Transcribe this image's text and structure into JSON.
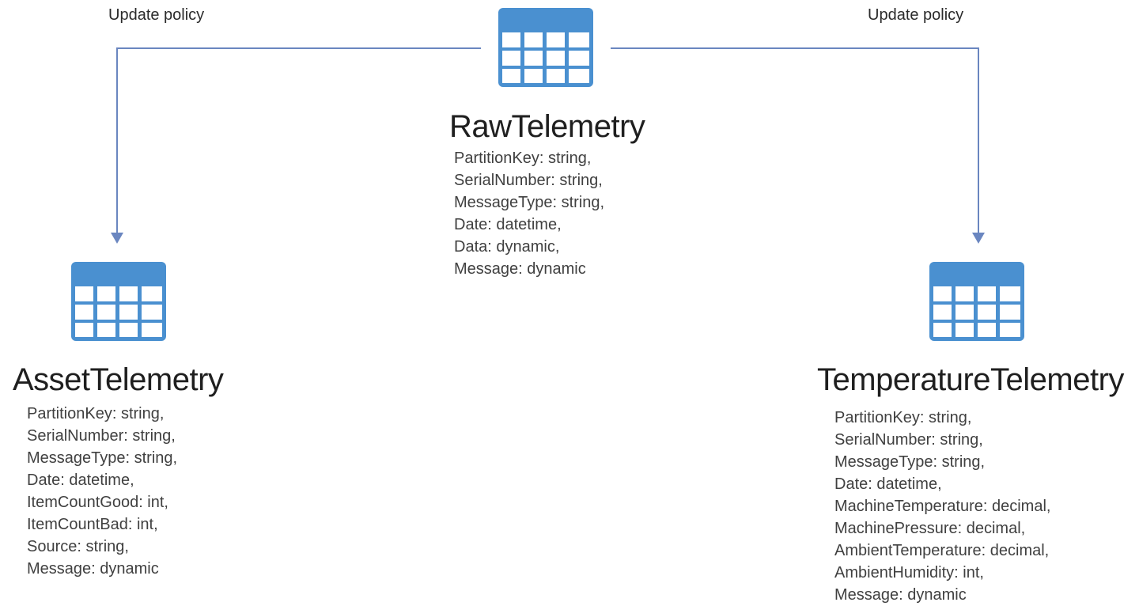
{
  "colors": {
    "icon_header": "#4a90d0",
    "icon_body": "#4a90d0",
    "icon_cell": "#ffffff",
    "connector": "#6a86c0",
    "title_text": "#1f1f1f",
    "field_text": "#404040"
  },
  "connectors": [
    {
      "label": "Update policy",
      "icon": "arrow-down-icon"
    },
    {
      "label": "Update policy",
      "icon": "arrow-down-icon"
    }
  ],
  "tables": {
    "raw": {
      "icon": "table-icon",
      "name": "RawTelemetry",
      "fields": [
        "PartitionKey: string,",
        "SerialNumber: string,",
        "MessageType: string,",
        "Date: datetime,",
        "Data: dynamic,",
        "Message: dynamic"
      ]
    },
    "asset": {
      "icon": "table-icon",
      "name": "AssetTelemetry",
      "fields": [
        "PartitionKey: string,",
        "SerialNumber: string,",
        "MessageType: string,",
        "Date: datetime,",
        "ItemCountGood: int,",
        "ItemCountBad: int,",
        "Source: string,",
        "Message: dynamic"
      ]
    },
    "temperature": {
      "icon": "table-icon",
      "name": "TemperatureTelemetry",
      "fields": [
        "PartitionKey: string,",
        "SerialNumber: string,",
        "MessageType: string,",
        "Date: datetime,",
        "MachineTemperature: decimal,",
        "MachinePressure: decimal,",
        "AmbientTemperature: decimal,",
        "AmbientHumidity: int,",
        "Message: dynamic"
      ]
    }
  }
}
